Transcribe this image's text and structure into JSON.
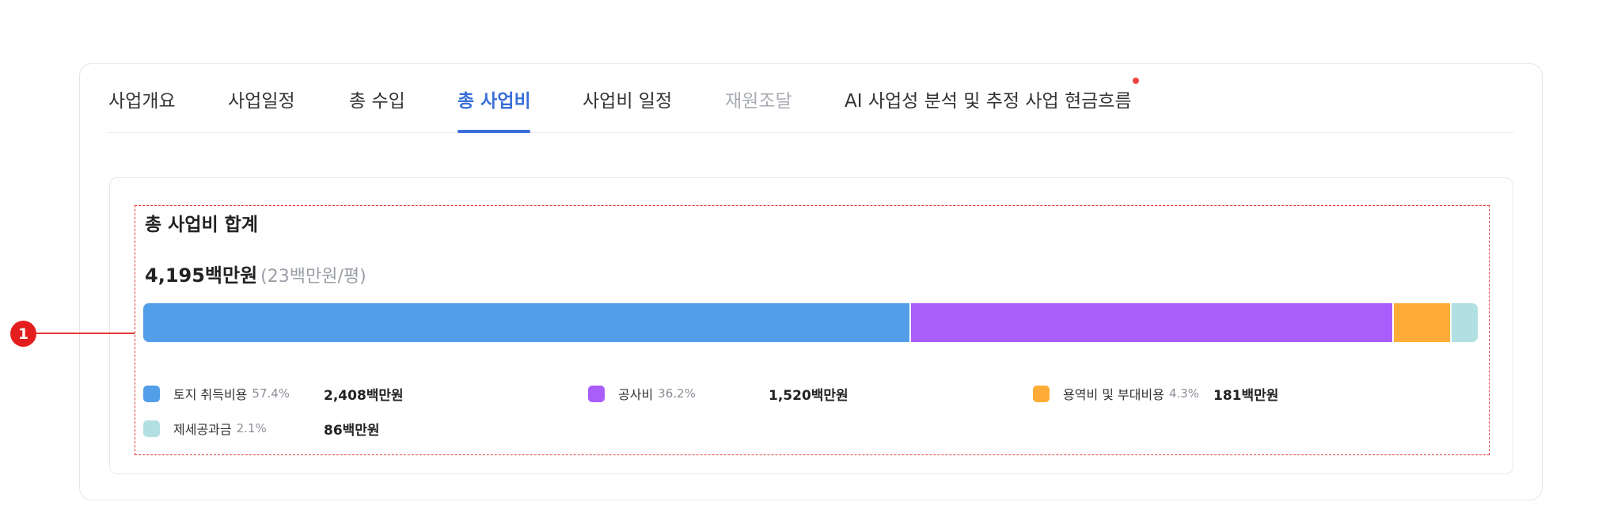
{
  "tabs": [
    {
      "label": "사업개요",
      "state": "normal"
    },
    {
      "label": "사업일정",
      "state": "normal"
    },
    {
      "label": "총 수입",
      "state": "normal"
    },
    {
      "label": "총 사업비",
      "state": "active"
    },
    {
      "label": "사업비 일정",
      "state": "normal"
    },
    {
      "label": "재원조달",
      "state": "disabled"
    },
    {
      "label": "AI 사업성 분석 및 추정 사업 현금흐름",
      "state": "normal"
    }
  ],
  "summary": {
    "title": "총 사업비 합계",
    "total_amount": "4,195백만원",
    "per_pyeong": "(23백만원/평)"
  },
  "breakdown": [
    {
      "label": "토지 취득비용",
      "percent_text": "57.4%",
      "percent": 57.4,
      "amount": "2,408백만원",
      "color": "#539ee9"
    },
    {
      "label": "공사비",
      "percent_text": "36.2%",
      "percent": 36.2,
      "amount": "1,520백만원",
      "color": "#a95ef9"
    },
    {
      "label": "용역비 및 부대비용",
      "percent_text": "4.3%",
      "percent": 4.3,
      "amount": "181백만원",
      "color": "#feac37"
    },
    {
      "label": "제세공과금",
      "percent_text": "2.1%",
      "percent": 2.1,
      "amount": "86백만원",
      "color": "#b2e0e2"
    }
  ],
  "annotation": {
    "marker": "1",
    "color": "#e41e1e"
  },
  "colors": {
    "accent": "#3a6fd8",
    "notify_dot": "#ef4444"
  }
}
